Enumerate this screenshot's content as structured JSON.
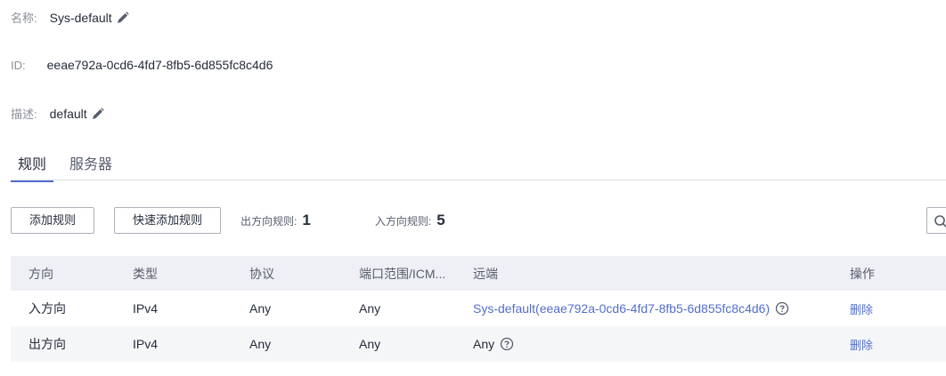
{
  "info": {
    "name_label": "名称:",
    "name_value": "Sys-default",
    "id_label": "ID:",
    "id_value": "eeae792a-0cd6-4fd7-8fb5-6d855fc8c4d6",
    "desc_label": "描述:",
    "desc_value": "default"
  },
  "tabs": [
    {
      "label": "规则",
      "active": true
    },
    {
      "label": "服务器",
      "active": false
    }
  ],
  "toolbar": {
    "add_rule": "添加规则",
    "quick_add_rule": "快速添加规则",
    "outbound_label": "出方向规则:",
    "outbound_count": "1",
    "inbound_label": "入方向规则:",
    "inbound_count": "5"
  },
  "table": {
    "columns": [
      "方向",
      "类型",
      "协议",
      "端口范围/ICM...",
      "远端",
      "操作"
    ],
    "rows": [
      {
        "direction": "入方向",
        "type": "IPv4",
        "protocol": "Any",
        "port": "Any",
        "remote": "Sys-default(eeae792a-0cd6-4fd7-8fb5-6d855fc8c4d6)",
        "remote_is_link": true,
        "action": "删除"
      },
      {
        "direction": "出方向",
        "type": "IPv4",
        "protocol": "Any",
        "port": "Any",
        "remote": "Any",
        "remote_is_link": false,
        "action": "删除"
      }
    ]
  },
  "colors": {
    "accent": "#526ecc",
    "header_bg": "#eef0f5",
    "alt_row_bg": "#f5f6f8",
    "text": "#252b3a",
    "muted": "#8a8e99"
  },
  "icons": {
    "edit": "pencil-icon",
    "help": "question-circle-icon",
    "search": "search-icon"
  }
}
